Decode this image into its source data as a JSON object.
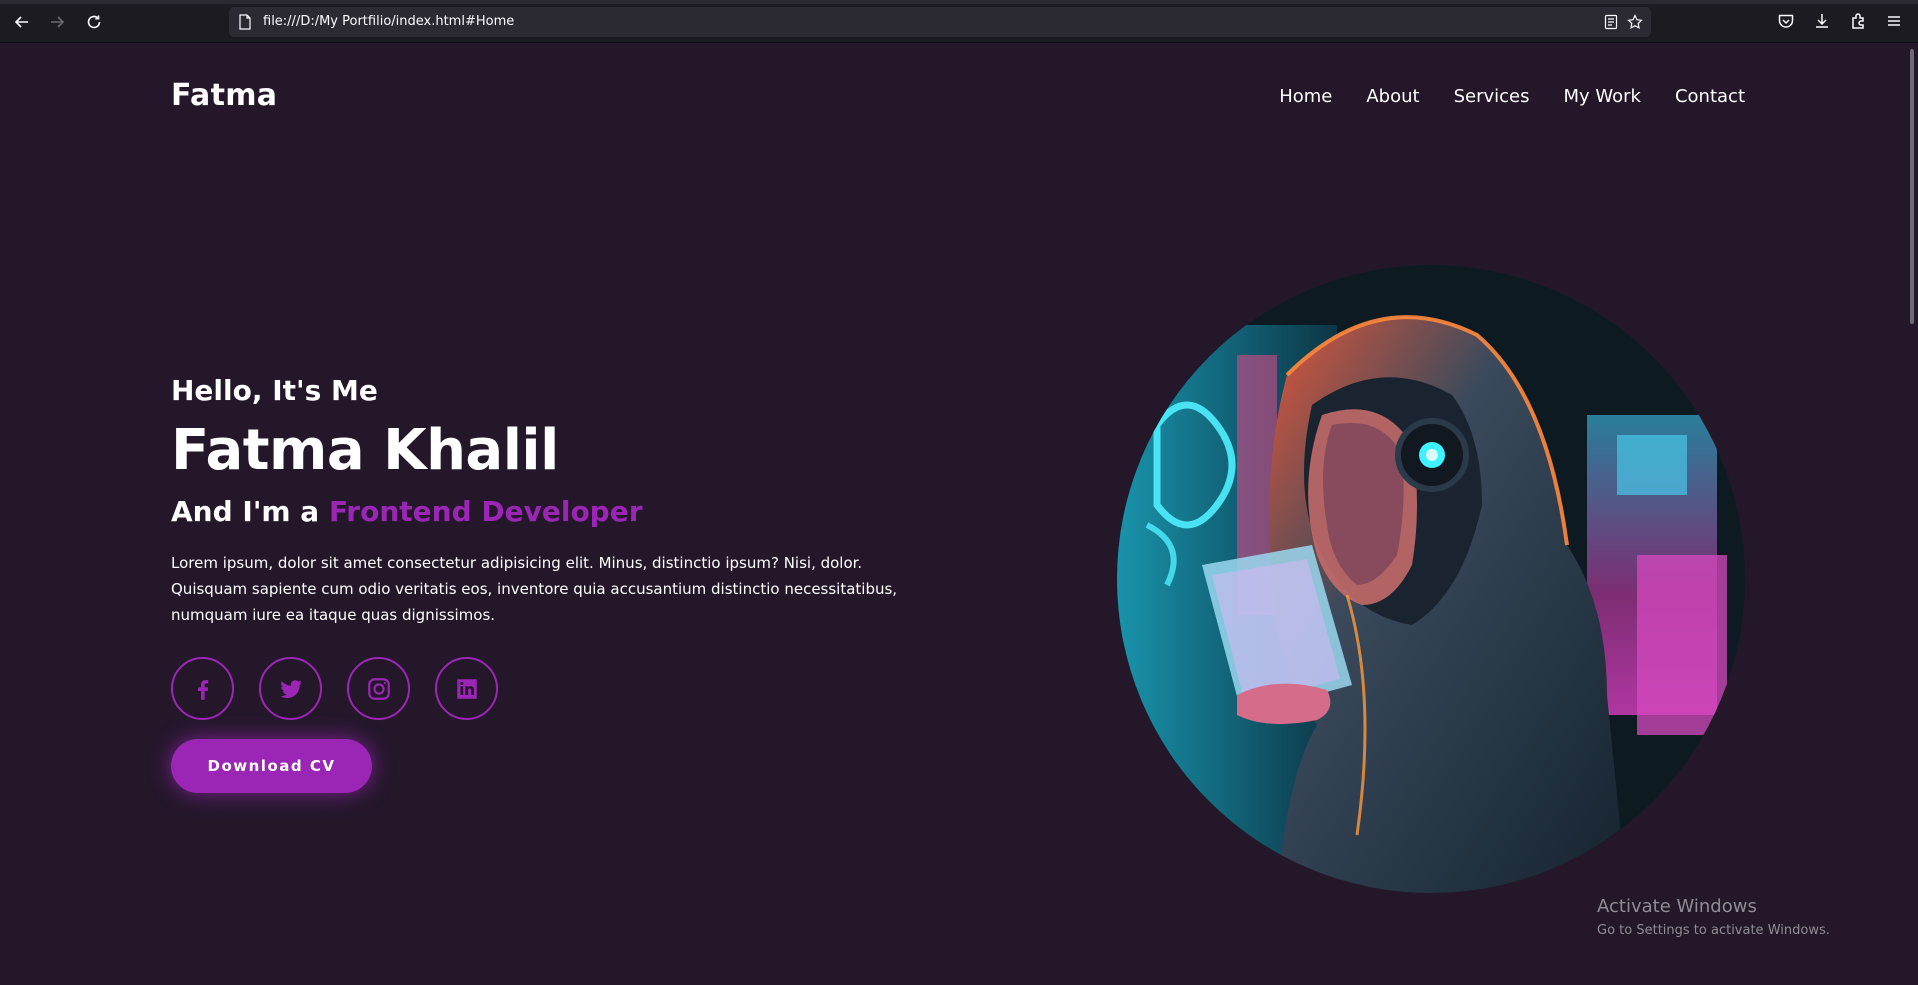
{
  "browser": {
    "url": "file:///D:/My Portfilio/index.html#Home",
    "icons": [
      "back-icon",
      "forward-icon",
      "reload-icon",
      "page-icon",
      "reader-view-icon",
      "bookmark-star-icon",
      "pocket-icon",
      "download-icon",
      "extensions-icon",
      "menu-icon"
    ]
  },
  "header": {
    "logo": "Fatma",
    "nav": [
      {
        "label": "Home"
      },
      {
        "label": "About"
      },
      {
        "label": "Services"
      },
      {
        "label": "My Work"
      },
      {
        "label": "Contact"
      }
    ]
  },
  "hero": {
    "greeting": "Hello, It's Me",
    "name": "Fatma Khalil",
    "role_prefix": "And I'm a ",
    "role_highlight": "Frontend Developer",
    "description": "Lorem ipsum, dolor sit amet consectetur adipisicing elit. Minus, distinctio ipsum? Nisi, dolor. Quisquam sapiente cum odio veritatis eos, inventore quia accusantium distinctio necessitatibus, numquam iure ea itaque quas dignissimos.",
    "socials": [
      {
        "name": "facebook-icon"
      },
      {
        "name": "twitter-icon"
      },
      {
        "name": "instagram-icon"
      },
      {
        "name": "linkedin-icon"
      }
    ],
    "cta": "Download CV",
    "image_alt": "hooded-girl-with-headphones-illustration"
  },
  "watermark": {
    "title": "Activate Windows",
    "subtitle": "Go to Settings to activate Windows."
  },
  "colors": {
    "background": "#24172a",
    "accent": "#9b26b6",
    "text": "#ffffff",
    "browser_bar": "#1c1b22"
  }
}
